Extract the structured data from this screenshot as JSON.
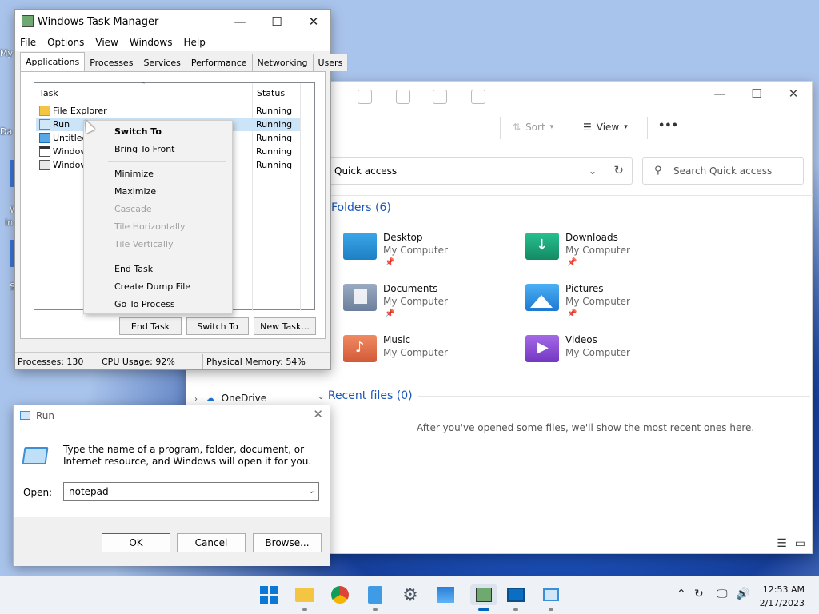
{
  "desktop": {
    "icon_fragments": [
      "My",
      "Da",
      "W",
      "In",
      "S"
    ]
  },
  "explorer": {
    "toolbar": {
      "sort_label": "Sort",
      "view_label": "View",
      "more_label": "•••"
    },
    "address": "Quick access",
    "search_placeholder": "Search Quick access",
    "folders_heading": "Folders (6)",
    "folders": [
      {
        "name": "Desktop",
        "sub": "My Computer",
        "color": "#1e90d6"
      },
      {
        "name": "Downloads",
        "sub": "My Computer",
        "color": "#1aa37a"
      },
      {
        "name": "Documents",
        "sub": "My Computer",
        "color": "#7f93ae"
      },
      {
        "name": "Pictures",
        "sub": "My Computer",
        "color": "#2f8fe0"
      },
      {
        "name": "Music",
        "sub": "My Computer",
        "color": "#e0704a"
      },
      {
        "name": "Videos",
        "sub": "My Computer",
        "color": "#8a4fd3"
      }
    ],
    "recent_heading": "Recent files (0)",
    "recent_message": "After you've opened some files, we'll show the most recent ones here.",
    "nav_visible": [
      "OneDrive"
    ]
  },
  "taskmgr": {
    "title": "Windows Task Manager",
    "menu": [
      "File",
      "Options",
      "View",
      "Windows",
      "Help"
    ],
    "tabs": [
      "Applications",
      "Processes",
      "Services",
      "Performance",
      "Networking",
      "Users"
    ],
    "columns": {
      "task": "Task",
      "status": "Status"
    },
    "rows": [
      {
        "name": "File Explorer",
        "status": "Running"
      },
      {
        "name": "Run",
        "status": "Running"
      },
      {
        "name": "Untitled",
        "status": "Running"
      },
      {
        "name": "Window",
        "status": "Running"
      },
      {
        "name": "Window",
        "status": "Running"
      }
    ],
    "buttons": {
      "end_task": "End Task",
      "switch_to": "Switch To",
      "new_task": "New Task..."
    },
    "status": {
      "processes": "Processes: 130",
      "cpu": "CPU Usage: 92%",
      "memory": "Physical Memory: 54%"
    }
  },
  "context_menu": {
    "items": [
      {
        "label": "Switch To",
        "enabled": true,
        "bold": true
      },
      {
        "label": "Bring To Front",
        "enabled": true
      },
      {
        "label": "Minimize",
        "enabled": true
      },
      {
        "label": "Maximize",
        "enabled": true
      },
      {
        "label": "Cascade",
        "enabled": false
      },
      {
        "label": "Tile Horizontally",
        "enabled": false
      },
      {
        "label": "Tile Vertically",
        "enabled": false
      },
      {
        "label": "End Task",
        "enabled": true
      },
      {
        "label": "Create Dump File",
        "enabled": true
      },
      {
        "label": "Go To Process",
        "enabled": true
      }
    ]
  },
  "run": {
    "title": "Run",
    "description": "Type the name of a program, folder, document, or Internet resource, and Windows will open it for you.",
    "open_label": "Open:",
    "open_value": "notepad",
    "buttons": {
      "ok": "OK",
      "cancel": "Cancel",
      "browse": "Browse..."
    }
  },
  "taskbar": {
    "clock_time": "12:53 AM",
    "clock_date": "2/17/2023"
  }
}
